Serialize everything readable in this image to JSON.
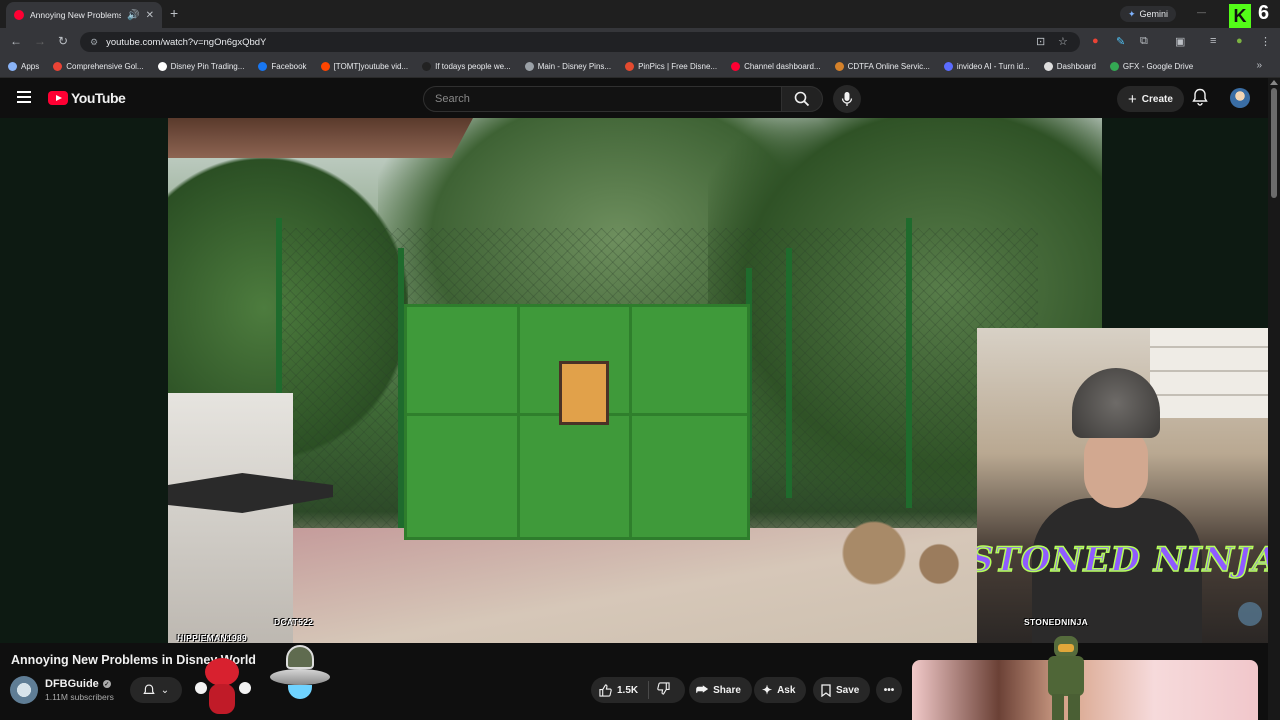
{
  "browser": {
    "tab_title": "Annoying New Problems in",
    "new_tab": "+",
    "close_tab": "✕",
    "gemini_label": "Gemini",
    "kick_badge": "6",
    "url": "youtube.com/watch?v=ngOn6gxQbdY"
  },
  "bookmarks": [
    {
      "label": "Apps",
      "color": "#8ab4f8"
    },
    {
      "label": "Comprehensive Gol...",
      "color": "#ea4335"
    },
    {
      "label": "Disney Pin Trading...",
      "color": "#ffffff"
    },
    {
      "label": "Facebook",
      "color": "#1877f2"
    },
    {
      "label": "[TOMT]youtube vid...",
      "color": "#ff4500"
    },
    {
      "label": "If todays people we...",
      "color": "#222222"
    },
    {
      "label": "Main - Disney Pins...",
      "color": "#9aa0a6"
    },
    {
      "label": "PinPics | Free Disne...",
      "color": "#e34a2f"
    },
    {
      "label": "Channel dashboard...",
      "color": "#ff0033"
    },
    {
      "label": "CDTFA Online Servic...",
      "color": "#d4812a"
    },
    {
      "label": "invideo AI - Turn id...",
      "color": "#5b6cff"
    },
    {
      "label": "Dashboard",
      "color": "#dddddd"
    },
    {
      "label": "GFX - Google Drive",
      "color": "#34a853"
    }
  ],
  "youtube": {
    "logo_text": "YouTube",
    "search_placeholder": "Search",
    "create_label": "Create"
  },
  "video": {
    "watermarks": {
      "hippieman": "HIPPIEMAN1989",
      "dcat": "DCAT522",
      "stonedninja": "STONEDNINJA"
    },
    "overlay_title": "STONED NINJA"
  },
  "meta": {
    "title": "Annoying New Problems in Disney World",
    "channel_name": "DFBGuide",
    "subscribers": "1.11M subscribers",
    "likes": "1.5K",
    "share_label": "Share",
    "ask_label": "Ask",
    "save_label": "Save"
  },
  "colors": {
    "youtube_red": "#ff0033",
    "kick_green": "#53fc18",
    "ninja_text": "#8f5bff"
  }
}
